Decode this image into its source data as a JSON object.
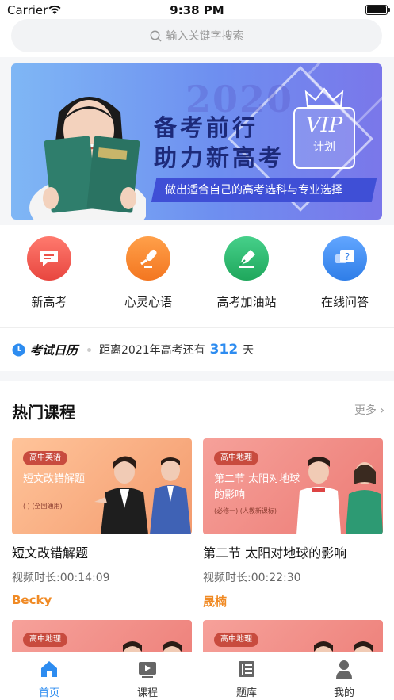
{
  "status_bar": {
    "carrier": "Carrier",
    "time": "9:38 PM"
  },
  "search": {
    "placeholder": "输入关键字搜索"
  },
  "banner": {
    "year": "2020",
    "line1": "备考前行",
    "line2": "助力新高考",
    "ribbon": "做出适合自己的高考选科与专业选择",
    "vip_title": "VIP",
    "vip_sub": "计划"
  },
  "quick_menu": [
    {
      "label": "新高考",
      "icon": "message-icon",
      "color": "#ef5350"
    },
    {
      "label": "心灵心语",
      "icon": "microphone-icon",
      "color": "#f5822a"
    },
    {
      "label": "高考加油站",
      "icon": "pen-icon",
      "color": "#2fb86e"
    },
    {
      "label": "在线问答",
      "icon": "question-icon",
      "color": "#3d8ef0"
    }
  ],
  "calendar": {
    "title": "考试日历",
    "prefix": "距离2021年高考还有",
    "days": "312",
    "suffix": "天"
  },
  "hot": {
    "title": "热门课程",
    "more": "更多"
  },
  "courses": [
    {
      "tag": "高中英语",
      "thumb_title": "短文改错解题",
      "thumb_sub": "(  ) (全国通用)",
      "title": "短文改错解题",
      "duration": "视频时长:00:14:09",
      "teacher": "Becky"
    },
    {
      "tag": "高中地理",
      "thumb_title": "第二节 太阳对地球的影响",
      "thumb_sub": "(必修一) (人教新课标)",
      "title": "第二节 太阳对地球的影响",
      "duration": "视频时长:00:22:30",
      "teacher": "晟楠"
    },
    {
      "tag": "高中地理"
    },
    {
      "tag": "高中地理"
    }
  ],
  "tabs": [
    {
      "label": "首页",
      "icon": "home-icon",
      "active": true
    },
    {
      "label": "课程",
      "icon": "play-icon"
    },
    {
      "label": "题库",
      "icon": "book-icon"
    },
    {
      "label": "我的",
      "icon": "user-icon"
    }
  ],
  "colors": {
    "accent": "#2d8cf0",
    "teacher": "#f08a24"
  }
}
